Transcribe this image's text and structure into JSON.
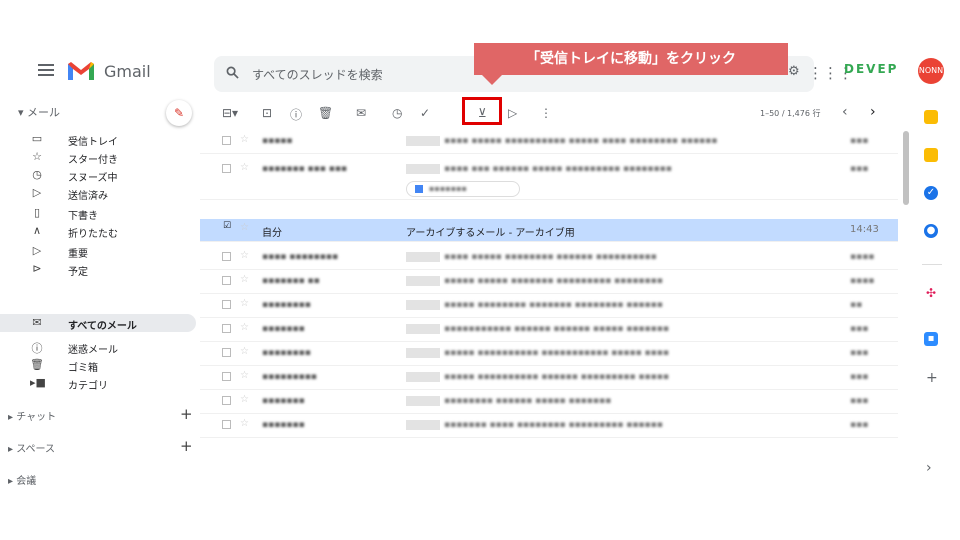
{
  "app": {
    "name": "Gmail"
  },
  "search": {
    "placeholder": "すべてのスレッドを検索"
  },
  "callout": {
    "text": "「受信トレイに移動」をクリック"
  },
  "header": {
    "brand_text": "DEVEP",
    "avatar_text": "NONN"
  },
  "sidebar": {
    "mail_header": "メール",
    "items": [
      {
        "icon": "inbox-icon",
        "label": "受信トレイ"
      },
      {
        "icon": "star-icon",
        "label": "スター付き"
      },
      {
        "icon": "clock-icon",
        "label": "スヌーズ中"
      },
      {
        "icon": "send-icon",
        "label": "送信済み"
      },
      {
        "icon": "draft-icon",
        "label": "下書き"
      },
      {
        "icon": "collapse-icon",
        "label": "折りたたむ"
      },
      {
        "icon": "important-icon",
        "label": "重要"
      },
      {
        "icon": "scheduled-icon",
        "label": "予定"
      },
      {
        "icon": "all-mail-icon",
        "label": "すべてのメール",
        "active": true
      },
      {
        "icon": "spam-icon",
        "label": "迷惑メール"
      },
      {
        "icon": "trash-icon",
        "label": "ゴミ箱"
      },
      {
        "icon": "label-icon",
        "label": "カテゴリ"
      }
    ],
    "chat": "チャット",
    "spaces": "スペース",
    "meet": "会議"
  },
  "toolbar": {
    "pager_text": "1–50 / 1,476 行",
    "icons": [
      "select-checkbox-icon",
      "archive-icon",
      "report-spam-icon",
      "delete-icon",
      "mark-unread-icon",
      "snooze-icon",
      "add-task-icon",
      "move-to-inbox-icon",
      "labels-icon",
      "more-icon"
    ]
  },
  "emails": [
    {
      "sender": "▪▪▪▪▪",
      "subject": "▪▪▪▪ ▪▪▪▪▪ ▪▪▪▪▪▪▪▪▪▪ ▪▪▪▪▪ ▪▪▪▪ ▪▪▪▪▪▪▪▪ ▪▪▪▪▪▪",
      "time": "▪▪▪"
    },
    {
      "sender": "▪▪▪▪▪▪▪ ▪▪▪ ▪▪▪",
      "subject": "▪▪▪▪ ▪▪▪ ▪▪▪▪▪▪ ▪▪▪▪▪ ▪▪▪▪▪▪▪▪▪ ▪▪▪▪▪▪▪▪",
      "time": "▪▪▪",
      "attachment": "▪▪▪▪▪▪▪"
    },
    {
      "sender": "自分",
      "subject": "アーカイブするメール - アーカイブ用",
      "time": "14:43",
      "selected": true
    },
    {
      "sender": "▪▪▪▪ ▪▪▪▪▪▪▪▪",
      "subject": "▪▪▪▪ ▪▪▪▪▪ ▪▪▪▪▪▪▪▪ ▪▪▪▪▪▪ ▪▪▪▪▪▪▪▪▪▪",
      "time": "▪▪▪▪"
    },
    {
      "sender": "▪▪▪▪▪▪▪ ▪▪",
      "subject": "▪▪▪▪▪ ▪▪▪▪▪ ▪▪▪▪▪▪▪ ▪▪▪▪▪▪▪▪▪ ▪▪▪▪▪▪▪▪",
      "time": "▪▪▪▪"
    },
    {
      "sender": "▪▪▪▪▪▪▪▪",
      "subject": "▪▪▪▪▪ ▪▪▪▪▪▪▪▪ ▪▪▪▪▪▪▪ ▪▪▪▪▪▪▪▪ ▪▪▪▪▪▪",
      "time": "▪▪"
    },
    {
      "sender": "▪▪▪▪▪▪▪",
      "subject": "▪▪▪▪▪▪▪▪▪▪▪ ▪▪▪▪▪▪ ▪▪▪▪▪▪ ▪▪▪▪▪ ▪▪▪▪▪▪▪",
      "time": "▪▪▪"
    },
    {
      "sender": "▪▪▪▪▪▪▪▪",
      "subject": "▪▪▪▪▪ ▪▪▪▪▪▪▪▪▪▪ ▪▪▪▪▪▪▪▪▪▪▪ ▪▪▪▪▪ ▪▪▪▪",
      "time": "▪▪▪"
    },
    {
      "sender": "▪▪▪▪▪▪▪▪▪",
      "subject": "▪▪▪▪▪ ▪▪▪▪▪▪▪▪▪▪ ▪▪▪▪▪▪ ▪▪▪▪▪▪▪▪▪ ▪▪▪▪▪",
      "time": "▪▪▪"
    },
    {
      "sender": "▪▪▪▪▪▪▪",
      "subject": "▪▪▪▪▪▪▪▪ ▪▪▪▪▪▪ ▪▪▪▪▪ ▪▪▪▪▪▪▪",
      "time": "▪▪▪"
    },
    {
      "sender": "▪▪▪▪▪▪▪",
      "subject": "▪▪▪▪▪▪▪ ▪▪▪▪ ▪▪▪▪▪▪▪▪ ▪▪▪▪▪▪▪▪▪ ▪▪▪▪▪▪",
      "time": "▪▪▪"
    }
  ],
  "colors": {
    "callout": "#e06666",
    "highlight": "#e00000",
    "selected_row": "#c2dbff",
    "brand": "#34a853"
  }
}
